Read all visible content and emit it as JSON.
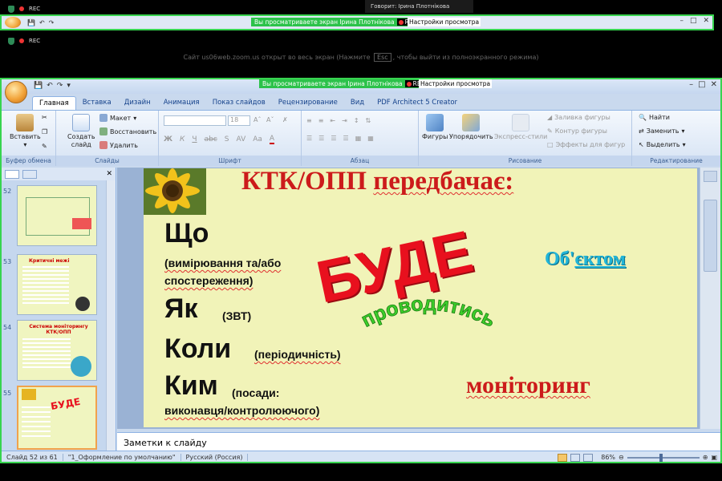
{
  "zoom": {
    "rec_label": "REC",
    "speaker_label": "Говорит: Ірина Плотнікова",
    "share_banner_text": "Вы просматриваете экран Ірина Плотнікова",
    "share_settings_label": "Настройки просмотра",
    "fullscreen_msg_before": "Сайт us06web.zoom.us открыт во весь экран (Нажмите",
    "fullscreen_msg_key": "Esc",
    "fullscreen_msg_after": ", чтобы выйти из полноэкранного режима)",
    "colors": {
      "share_green": "#2cc24a",
      "rec_red": "#e33333"
    }
  },
  "ppt": {
    "tabs": [
      "Главная",
      "Вставка",
      "Дизайн",
      "Анимация",
      "Показ слайдов",
      "Рецензирование",
      "Вид",
      "PDF Architect 5 Creator"
    ],
    "active_tab": "Главная",
    "ribbon": {
      "clipboard": {
        "insert": "Вставить",
        "label": "Буфер обмена"
      },
      "slides": {
        "create": "Создать",
        "create2": "слайд",
        "layout": "Макет",
        "restore": "Восстановить",
        "delete": "Удалить",
        "label": "Слайды"
      },
      "font": {
        "size": "18",
        "label": "Шрифт"
      },
      "paragraph": {
        "label": "Абзац"
      },
      "drawing": {
        "shapes": "Фигуры",
        "arrange": "Упорядочить",
        "quick_styles": "Экспресс-стили",
        "fill": "Заливка фигуры",
        "outline": "Контур фигуры",
        "effects": "Эффекты для фигур",
        "label": "Рисование"
      },
      "editing": {
        "find": "Найти",
        "replace": "Заменить",
        "select": "Выделить",
        "label": "Редактирование"
      }
    },
    "thumbnails": [
      {
        "num": "52",
        "title": ""
      },
      {
        "num": "53",
        "title": "Критичні межі (КТК/ОПП)"
      },
      {
        "num": "54",
        "title": "Система моніторингу КТК/ОПП"
      },
      {
        "num": "55",
        "title": "Система моніторингу КТК/ОПП передбачає"
      }
    ],
    "thumb_53_text": "Критичні межі",
    "thumb_54_text": "Система моніторингу КТК/ОПП",
    "thumb_55_text": "БУДЕ",
    "notes_label": "Заметки к слайду",
    "status": {
      "slide": "Слайд 52 из 61",
      "theme": "\"1_Оформление по умолчанию\"",
      "lang": "Русский (Россия)",
      "zoom": "86%"
    }
  },
  "slide": {
    "title_a": "КТК/ОПП ",
    "title_b": "передбачає:",
    "line1": "Що",
    "line1_sub_a": "(вимірювання та/або",
    "line1_sub_b": "спостереження)",
    "line2": "Як",
    "line2_sub": "(ЗВТ)",
    "line3": "Коли",
    "line3_sub": "(періодичність)",
    "line4": "Ким",
    "line4_sub_a": "(посади:",
    "line4_sub_b": "виконавця/контролюючого)",
    "bude": "БУДЕ",
    "provod": "проводитись",
    "obiekt_a": "Об'",
    "obiekt_b": "єктом",
    "monitoring": "моніторинг",
    "colors": {
      "title_red": "#cc1b1b",
      "bude_red": "#e8101e",
      "green": "#3ccf2a",
      "cyan": "#22b5d8",
      "slide_bg": "#f1f3b8"
    }
  }
}
